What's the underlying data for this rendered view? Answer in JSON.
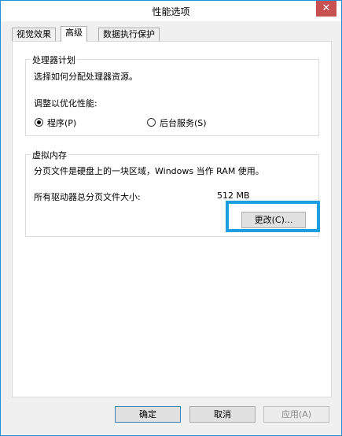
{
  "window": {
    "title": "性能选项",
    "close_glyph": "✕"
  },
  "tabs": [
    {
      "label": "视觉效果",
      "active": false
    },
    {
      "label": "高级",
      "active": true
    },
    {
      "label": "数据执行保护",
      "active": false
    }
  ],
  "processor": {
    "title": "处理器计划",
    "description": "选择如何分配处理器资源。",
    "optimize_label": "调整以优化性能:",
    "option_programs": "程序(P)",
    "option_background": "后台服务(S)",
    "selected": "程序(P)"
  },
  "virtual_memory": {
    "title": "虚拟内存",
    "description": "分页文件是硬盘上的一块区域，Windows 当作 RAM 使用。",
    "total_label": "所有驱动器总分页文件大小:",
    "total_value": "512 MB",
    "change_button": "更改(C)..."
  },
  "footer": {
    "ok": "确定",
    "cancel": "取消",
    "apply": "应用(A)"
  },
  "colors": {
    "highlight": "#1e9ee0",
    "close_button": "#c75050"
  }
}
